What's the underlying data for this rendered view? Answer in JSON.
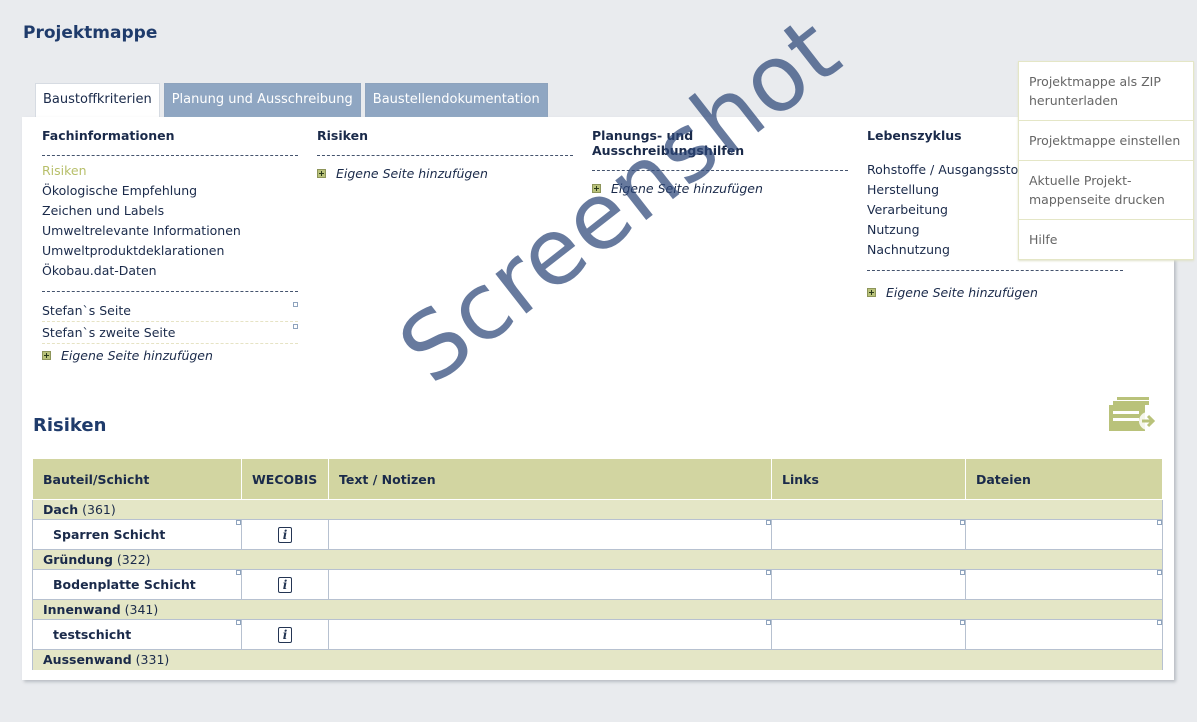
{
  "page_title": "Projektmappe",
  "tabs": [
    {
      "label": "Baustoffkriterien",
      "active": true
    },
    {
      "label": "Planung und Ausschreibung",
      "active": false
    },
    {
      "label": "Baustellendokumentation",
      "active": false
    }
  ],
  "columns": {
    "fachinfo": {
      "title": "Fachinformationen",
      "links": [
        "Risiken",
        "Ökologische Empfehlung",
        "Zeichen und Labels",
        "Umweltrelevante Informationen",
        "Umweltproduktdeklarationen",
        "Ökobau.dat-Daten"
      ],
      "own_pages": [
        "Stefan`s Seite",
        "Stefan`s zweite Seite"
      ],
      "add_label": "Eigene Seite hinzufügen"
    },
    "risiken": {
      "title": "Risiken",
      "add_label": "Eigene Seite hinzufügen"
    },
    "planung": {
      "title": "Planungs- und Ausschreibungshilfen",
      "add_label": "Eigene Seite hinzufügen"
    },
    "lebenszyklus": {
      "title": "Lebenszyklus",
      "links": [
        "Rohstoffe / Ausgangsstoffe",
        "Herstellung",
        "Verarbeitung",
        "Nutzung",
        "Nachnutzung"
      ],
      "add_label": "Eigene Seite hinzufügen"
    }
  },
  "section_title": "Risiken",
  "table": {
    "headers": [
      "Bauteil/Schicht",
      "WECOBIS",
      "Text / Notizen",
      "Links",
      "Dateien"
    ],
    "groups": [
      {
        "name": "Dach",
        "count": "(361)",
        "rows": [
          "Sparren Schicht"
        ]
      },
      {
        "name": "Gründung",
        "count": "(322)",
        "rows": [
          "Bodenplatte Schicht"
        ]
      },
      {
        "name": "Innenwand",
        "count": "(341)",
        "rows": [
          "testschicht"
        ]
      },
      {
        "name": "Aussenwand",
        "count": "(331)",
        "rows": []
      }
    ],
    "info_glyph": "i"
  },
  "dropdown": [
    "Projektmappe als ZIP herunterladen",
    "Projektmappe einstellen",
    "Aktuelle Projekt-mappenseite drucken",
    "Hilfe"
  ],
  "watermark": "Screenshot",
  "colors": {
    "accent": "#1f3b6b",
    "tab_inactive": "#8fa6c2",
    "table_header": "#d2d5a1",
    "group_row": "#e4e6c6",
    "current_link": "#b7bf6a"
  }
}
